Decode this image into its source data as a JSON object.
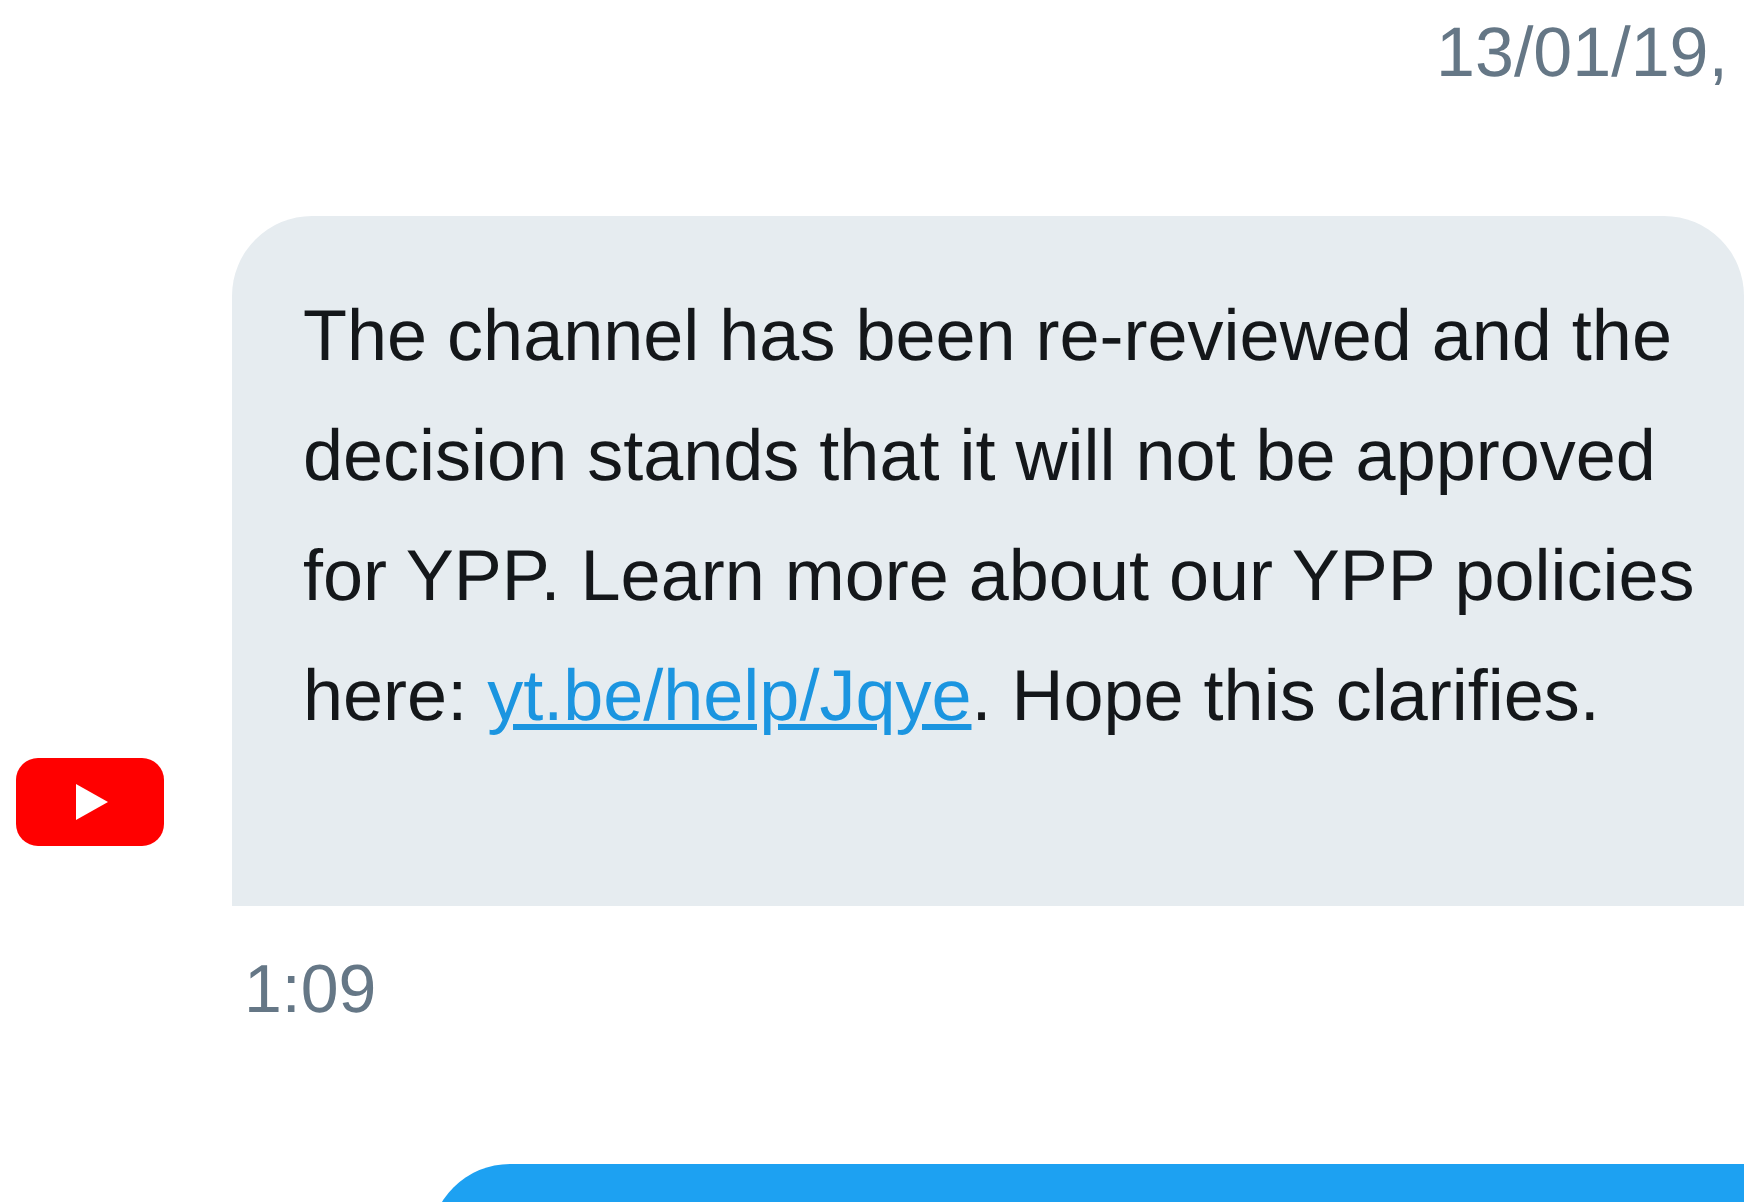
{
  "date_header": "13/01/19,",
  "message": {
    "text_before": "The channel has been re-reviewed and the decision stands that it will not be approved for YPP. Learn more about our YPP policies here: ",
    "link": "yt.be/help/Jqye",
    "text_after": ". Hope this clarifies.",
    "time": "1:09"
  }
}
